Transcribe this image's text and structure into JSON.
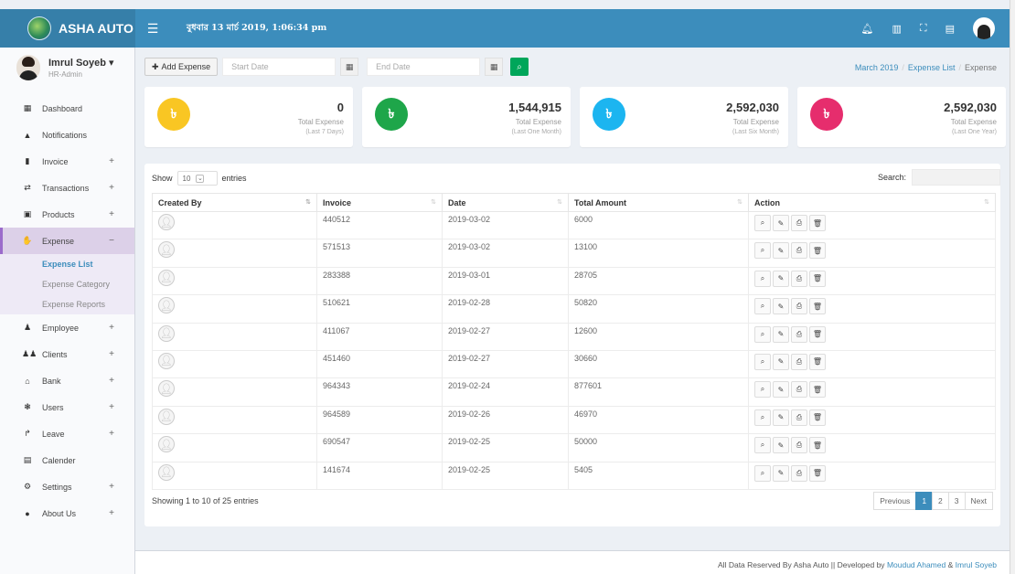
{
  "header": {
    "brand": "ASHA AUTO",
    "datetime": "বুধবার 13 মার্চ 2019, 1:06:34 pm"
  },
  "sidebar": {
    "user_name": "Imrul Soyeb",
    "user_role": "HR-Admin",
    "items": [
      {
        "label": "Dashboard",
        "icon": "dashboard-icon"
      },
      {
        "label": "Notifications",
        "icon": "bell-icon"
      },
      {
        "label": "Invoice",
        "icon": "file-icon",
        "sign": "+"
      },
      {
        "label": "Transactions",
        "icon": "exchange-icon",
        "sign": "+"
      },
      {
        "label": "Products",
        "icon": "box-icon",
        "sign": "+"
      },
      {
        "label": "Expense",
        "icon": "money-hand-icon",
        "sign": "−"
      },
      {
        "label": "Employee",
        "icon": "user-icon",
        "sign": "+"
      },
      {
        "label": "Clients",
        "icon": "users-icon",
        "sign": "+"
      },
      {
        "label": "Bank",
        "icon": "bank-icon",
        "sign": "+"
      },
      {
        "label": "Users",
        "icon": "user-group-icon",
        "sign": "+"
      },
      {
        "label": "Leave",
        "icon": "leave-icon",
        "sign": "+"
      },
      {
        "label": "Calender",
        "icon": "calendar-icon"
      },
      {
        "label": "Settings",
        "icon": "gears-icon",
        "sign": "+"
      },
      {
        "label": "About Us",
        "icon": "map-marker-icon",
        "sign": "+"
      }
    ],
    "expense_sub": [
      "Expense List",
      "Expense Category",
      "Expense Reports"
    ]
  },
  "filter": {
    "add_label": "Add Expense",
    "start_placeholder": "Start Date",
    "end_placeholder": "End Date"
  },
  "breadcrumb": [
    "March 2019",
    "Expense List",
    "Expense"
  ],
  "stats": [
    {
      "value": "0",
      "label": "Total Expense",
      "sub": "(Last 7 Days)",
      "color": "#f9c623"
    },
    {
      "value": "1,544,915",
      "label": "Total Expense",
      "sub": "(Last One Month)",
      "color": "#1ea64a"
    },
    {
      "value": "2,592,030",
      "label": "Total Expense",
      "sub": "(Last Six Month)",
      "color": "#1cb5f0"
    },
    {
      "value": "2,592,030",
      "label": "Total Expense",
      "sub": "(Last One Year)",
      "color": "#e62d6d"
    }
  ],
  "table": {
    "show": "Show",
    "length": "10",
    "entries": "entries",
    "search": "Search:",
    "headers": [
      "Created By",
      "Invoice",
      "Date",
      "Total Amount",
      "Action"
    ],
    "rows": [
      {
        "invoice": "440512",
        "date": "2019-03-02",
        "amount": "6000"
      },
      {
        "invoice": "571513",
        "date": "2019-03-02",
        "amount": "13100"
      },
      {
        "invoice": "283388",
        "date": "2019-03-01",
        "amount": "28705"
      },
      {
        "invoice": "510621",
        "date": "2019-02-28",
        "amount": "50820"
      },
      {
        "invoice": "411067",
        "date": "2019-02-27",
        "amount": "12600"
      },
      {
        "invoice": "451460",
        "date": "2019-02-27",
        "amount": "30660"
      },
      {
        "invoice": "964343",
        "date": "2019-02-24",
        "amount": "877601"
      },
      {
        "invoice": "964589",
        "date": "2019-02-26",
        "amount": "46970"
      },
      {
        "invoice": "690547",
        "date": "2019-02-25",
        "amount": "50000"
      },
      {
        "invoice": "141674",
        "date": "2019-02-25",
        "amount": "5405"
      }
    ],
    "showing": "Showing 1 to 10 of 25 entries",
    "pager": [
      "Previous",
      "1",
      "2",
      "3",
      "Next"
    ]
  },
  "footer": {
    "prefix": "All Data Reserved By Asha Auto || Developed by",
    "dev1": "Moudud Ahamed",
    "amp": "&",
    "dev2": "Imrul Soyeb"
  }
}
